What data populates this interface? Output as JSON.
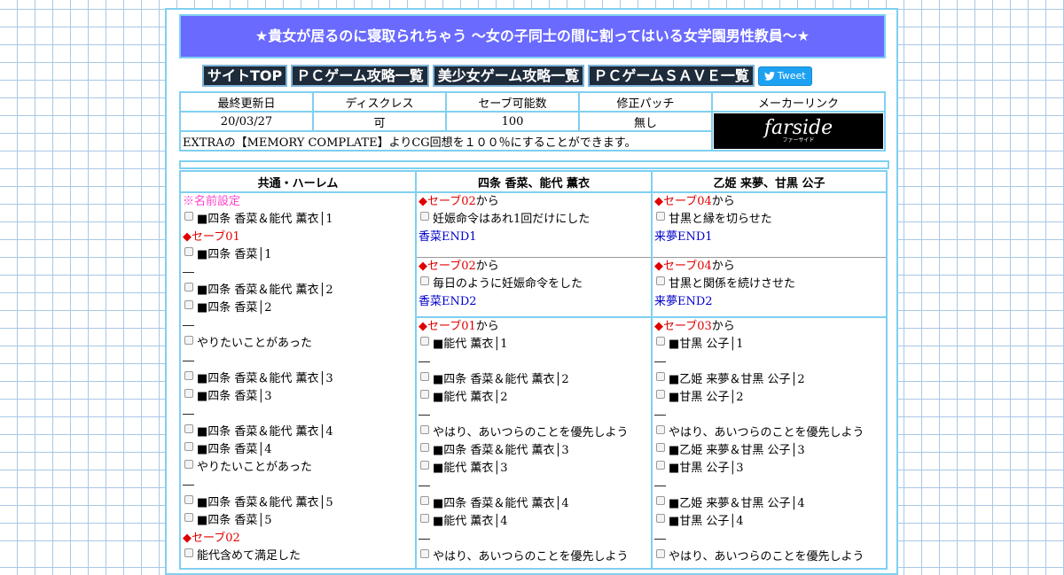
{
  "title": "★貴女が居るのに寝取られちゃう ～女の子同士の間に割ってはいる女学園男性教員～★",
  "nav": {
    "top": "サイトTOP",
    "pc_list": "ＰＣゲーム攻略一覧",
    "bishoujo_list": "美少女ゲーム攻略一覧",
    "save_list": "ＰＣゲームＳＡＶＥ一覧",
    "tweet": "Tweet"
  },
  "info": {
    "headers": [
      "最終更新日",
      "ディスクレス",
      "セーブ可能数",
      "修正パッチ",
      "メーカーリンク"
    ],
    "values": [
      "20/03/27",
      "可",
      "100",
      "無し"
    ],
    "maker_logo": "farside",
    "maker_logo_sub": "ファーサイド",
    "note": "EXTRAの【MEMORY COMPLATE】よりCG回想を１００％にすることができます。"
  },
  "routes": {
    "headers": [
      "共通・ハーレム",
      "四条 香菜、能代 薫衣",
      "乙姫 来夢、甘黒 公子"
    ],
    "col1": {
      "name_setting": "※名前設定",
      "c1": "■四条 香菜＆能代 薫衣│1",
      "save01": "◆セーブ01",
      "c2": "■四条 香菜│1",
      "dash": "―",
      "c3": "■四条 香菜＆能代 薫衣│2",
      "c4": "■四条 香菜│2",
      "c5": "やりたいことがあった",
      "c6": "■四条 香菜＆能代 薫衣│3",
      "c7": "■四条 香菜│3",
      "c8": "■四条 香菜＆能代 薫衣│4",
      "c9": "■四条 香菜│4",
      "c10": "やりたいことがあった",
      "c11": "■四条 香菜＆能代 薫衣│5",
      "c12": "■四条 香菜│5",
      "save02": "◆セーブ02",
      "c13": "能代含めて満足した"
    },
    "col2": {
      "b1_save": "◆セーブ02",
      "from": "から",
      "b1_choice": "妊娠命令はあれ1回だけにした",
      "b1_end": "香菜END1",
      "b2_save": "◆セーブ02",
      "b2_choice": "毎日のように妊娠命令をした",
      "b2_end": "香菜END2",
      "b3_save": "◆セーブ01",
      "c1": "■能代 薫衣│1",
      "c2": "■四条 香菜＆能代 薫衣│2",
      "c3": "■能代 薫衣│2",
      "c4": "やはり、あいつらのことを優先しよう",
      "c5": "■四条 香菜＆能代 薫衣│3",
      "c6": "■能代 薫衣│3",
      "c7": "■四条 香菜＆能代 薫衣│4",
      "c8": "■能代 薫衣│4",
      "c9": "やはり、あいつらのことを優先しよう"
    },
    "col3": {
      "b1_save": "◆セーブ04",
      "b1_choice": "甘黒と縁を切らせた",
      "b1_end": "来夢END1",
      "b2_save": "◆セーブ04",
      "b2_choice": "甘黒と関係を続けさせた",
      "b2_end": "来夢END2",
      "b3_save": "◆セーブ03",
      "c1": "■甘黒 公子│1",
      "c2": "■乙姫 来夢＆甘黒 公子│2",
      "c3": "■甘黒 公子│2",
      "c4": "やはり、あいつらのことを優先しよう",
      "c5": "■乙姫 来夢＆甘黒 公子│3",
      "c6": "■甘黒 公子│3",
      "c7": "■乙姫 来夢＆甘黒 公子│4",
      "c8": "■甘黒 公子│4",
      "c9": "やはり、あいつらのことを優先しよう"
    }
  }
}
